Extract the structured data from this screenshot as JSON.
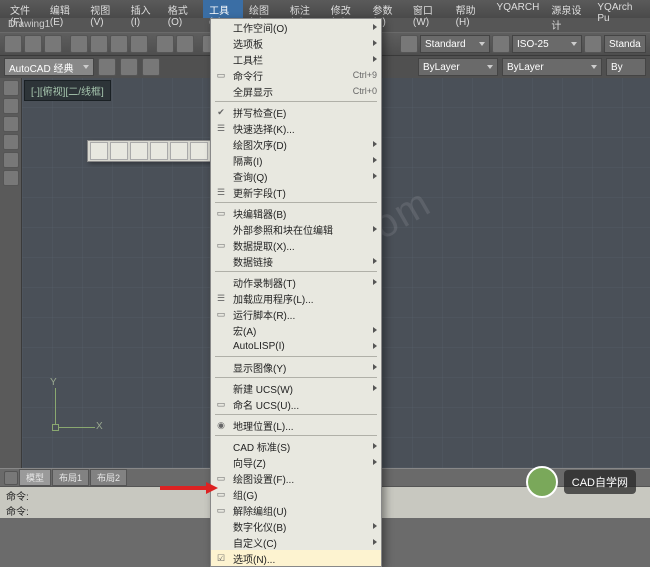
{
  "menubar": {
    "items": [
      "文件(F)",
      "编辑(E)",
      "视图(V)",
      "插入(I)",
      "格式(O)",
      "工具(T)",
      "绘图(D)",
      "标注(N)",
      "修改(M)",
      "参数(P)",
      "窗口(W)",
      "帮助(H)",
      "YQARCH",
      "源泉设计",
      "YQArch Pu"
    ],
    "active_index": 5
  },
  "titlebar": {
    "doc": "Drawing1"
  },
  "toolbar2": {
    "style_combo": "Standard",
    "dim_combo": "ISO-25",
    "right_combo": "Standa"
  },
  "workspace": {
    "label": "AutoCAD 经典",
    "layer_combo": "ByLayer",
    "linetype_combo": "ByLayer",
    "color_combo": "By"
  },
  "view_tab": "[-][俯视][二/线框]",
  "ucs": {
    "y": "Y",
    "x": "X"
  },
  "dropdown": [
    {
      "label": "工作空间(O)",
      "icon": "",
      "submenu": true
    },
    {
      "label": "选项板",
      "icon": "",
      "submenu": true
    },
    {
      "label": "工具栏",
      "icon": "",
      "submenu": true
    },
    {
      "label": "命令行",
      "icon": "▭",
      "shortcut": "Ctrl+9"
    },
    {
      "label": "全屏显示",
      "icon": "",
      "shortcut": "Ctrl+0"
    },
    {
      "sep": true
    },
    {
      "label": "拼写检查(E)",
      "icon": "✔"
    },
    {
      "label": "快速选择(K)...",
      "icon": "☰"
    },
    {
      "label": "绘图次序(D)",
      "icon": "",
      "submenu": true
    },
    {
      "label": "隔离(I)",
      "icon": "",
      "submenu": true
    },
    {
      "label": "查询(Q)",
      "icon": "",
      "submenu": true
    },
    {
      "label": "更新字段(T)",
      "icon": "☰"
    },
    {
      "sep": true
    },
    {
      "label": "块编辑器(B)",
      "icon": "▭"
    },
    {
      "label": "外部参照和块在位编辑",
      "icon": "",
      "submenu": true
    },
    {
      "label": "数据提取(X)...",
      "icon": "▭"
    },
    {
      "label": "数据链接",
      "icon": "",
      "submenu": true
    },
    {
      "sep": true
    },
    {
      "label": "动作录制器(T)",
      "icon": "",
      "submenu": true
    },
    {
      "label": "加载应用程序(L)...",
      "icon": "☰"
    },
    {
      "label": "运行脚本(R)...",
      "icon": "▭"
    },
    {
      "label": "宏(A)",
      "icon": "",
      "submenu": true
    },
    {
      "label": "AutoLISP(I)",
      "icon": "",
      "submenu": true
    },
    {
      "sep": true
    },
    {
      "label": "显示图像(Y)",
      "icon": "",
      "submenu": true
    },
    {
      "sep": true
    },
    {
      "label": "新建 UCS(W)",
      "icon": "",
      "submenu": true
    },
    {
      "label": "命名 UCS(U)...",
      "icon": "▭"
    },
    {
      "sep": true
    },
    {
      "label": "地理位置(L)...",
      "icon": "◉"
    },
    {
      "sep": true
    },
    {
      "label": "CAD 标准(S)",
      "icon": "",
      "submenu": true
    },
    {
      "label": "向导(Z)",
      "icon": "",
      "submenu": true
    },
    {
      "label": "绘图设置(F)...",
      "icon": "▭"
    },
    {
      "label": "组(G)",
      "icon": "▭"
    },
    {
      "label": "解除编组(U)",
      "icon": "▭"
    },
    {
      "label": "数字化仪(B)",
      "icon": "",
      "submenu": true
    },
    {
      "label": "自定义(C)",
      "icon": "",
      "submenu": true
    },
    {
      "label": "选项(N)...",
      "icon": "☑",
      "highlight": true
    }
  ],
  "bottom_tabs": {
    "items": [
      "模型",
      "布局1",
      "布局2"
    ],
    "active_index": 0
  },
  "cmdline": {
    "line1": "命令:",
    "line2": "命令:"
  },
  "watermark": "cadzxw.com",
  "bubble": {
    "text": "CAD自学网"
  }
}
